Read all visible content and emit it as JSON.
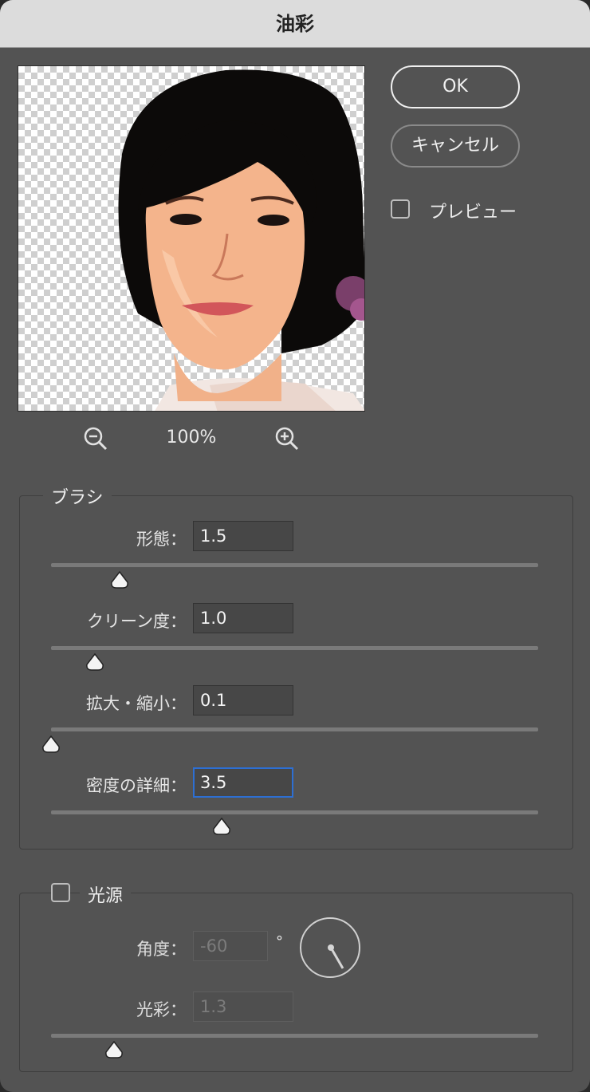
{
  "window": {
    "title": "油彩"
  },
  "buttons": {
    "ok": "OK",
    "cancel": "キャンセル"
  },
  "preview_toggle": {
    "label": "プレビュー",
    "checked": false
  },
  "zoom": {
    "level": "100%"
  },
  "brush": {
    "title": "ブラシ",
    "stylization": {
      "label": "形態：",
      "value": "1.5",
      "slider": 0.14
    },
    "cleanliness": {
      "label": "クリーン度：",
      "value": "1.0",
      "slider": 0.09
    },
    "scale": {
      "label": "拡大・縮小：",
      "value": "0.1",
      "slider": 0.0
    },
    "bristle_detail": {
      "label": "密度の詳細：",
      "value": "3.5",
      "slider": 0.35
    }
  },
  "lighting": {
    "title": "光源",
    "enabled": false,
    "angle": {
      "label": "角度：",
      "value": "-60",
      "unit": "°"
    },
    "shine": {
      "label": "光彩：",
      "value": "1.3",
      "slider": 0.13
    }
  },
  "colors": {
    "dialog_bg": "#535353",
    "focus_ring": "#2d6fd3",
    "titlebar": "#dcdcdc"
  }
}
